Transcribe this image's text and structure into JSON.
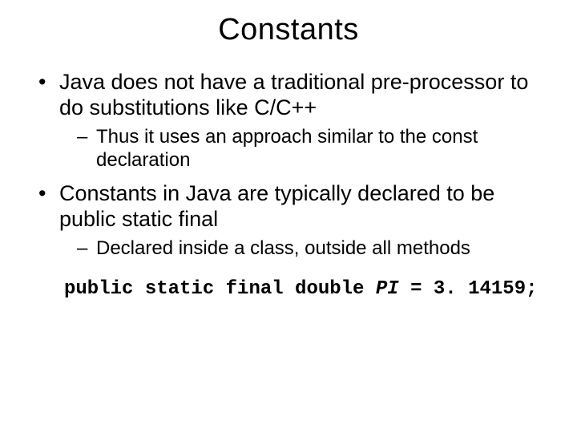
{
  "title": "Constants",
  "bullets": [
    {
      "text": "Java does not have a traditional pre-processor to do substitutions like C/C++",
      "sub": [
        "Thus it uses an approach similar to the const declaration"
      ]
    },
    {
      "text": "Constants in Java are typically declared to be public static final",
      "sub": [
        "Declared inside a class, outside all methods"
      ]
    }
  ],
  "code": {
    "prefix": "public static final double ",
    "ident": "PI",
    "suffix": " = 3. 14159;"
  }
}
